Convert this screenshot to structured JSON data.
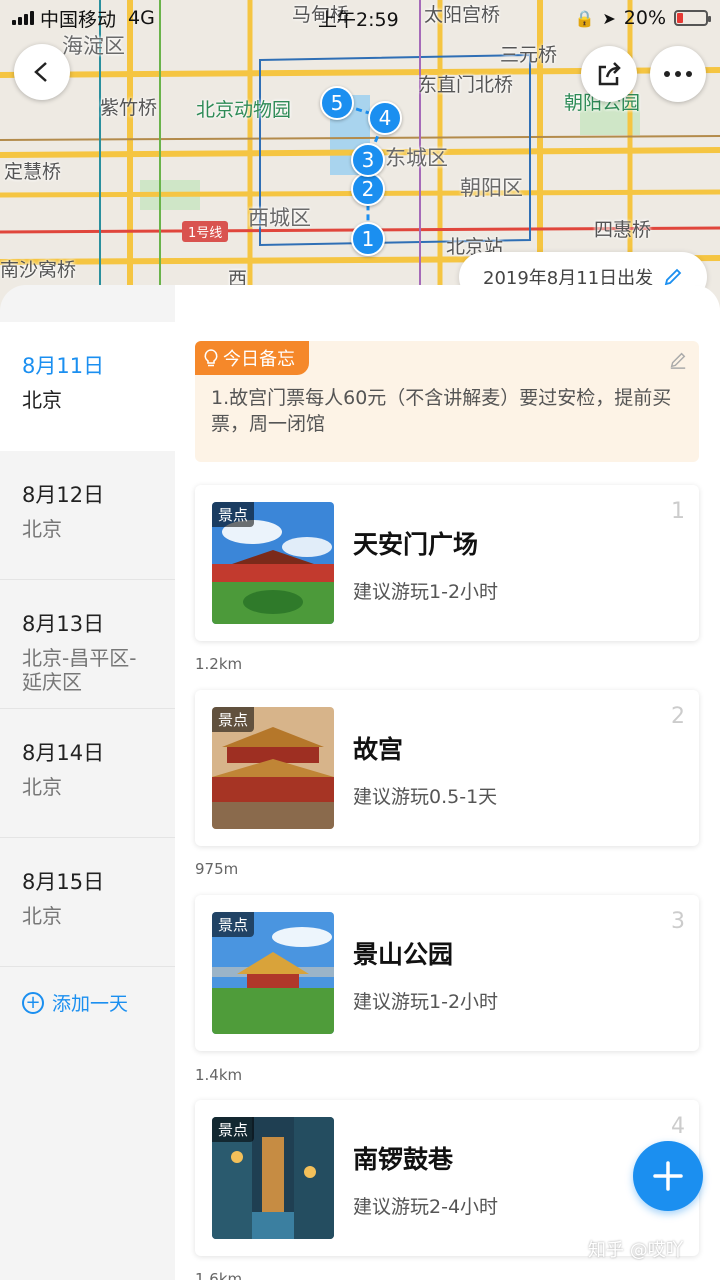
{
  "status_bar": {
    "carrier": "中国移动",
    "network": "4G",
    "time": "上午2:59",
    "battery_percent": "20%",
    "battery_level": 0.2
  },
  "map": {
    "labels": [
      "海淀区",
      "紫竹桥",
      "北京动物园",
      "东直门北桥",
      "三元桥",
      "东城区",
      "朝阳区",
      "西城区",
      "定慧桥",
      "四惠桥",
      "北京站",
      "南沙窝桥",
      "1号线",
      "马甸桥",
      "太阳宫桥",
      "朝阳公园",
      "西"
    ],
    "pins": [
      "1",
      "2",
      "3",
      "4",
      "5"
    ]
  },
  "date_pill": "2019年8月11日出发",
  "sidebar": {
    "days": [
      {
        "date": "8月11日",
        "city": "北京"
      },
      {
        "date": "8月12日",
        "city": "北京"
      },
      {
        "date": "8月13日",
        "city": "北京-昌平区-延庆区"
      },
      {
        "date": "8月14日",
        "city": "北京"
      },
      {
        "date": "8月15日",
        "city": "北京"
      }
    ],
    "add_day": "添加一天"
  },
  "memo": {
    "tag": "今日备忘",
    "text": "1.故宫门票每人60元（不含讲解麦）要过安检，提前买票，周一闭馆"
  },
  "spots": [
    {
      "tag": "景点",
      "name": "天安门广场",
      "sub": "建议游玩1-2小时",
      "num": "1"
    },
    {
      "tag": "景点",
      "name": "故宫",
      "sub": "建议游玩0.5-1天",
      "num": "2"
    },
    {
      "tag": "景点",
      "name": "景山公园",
      "sub": "建议游玩1-2小时",
      "num": "3"
    },
    {
      "tag": "景点",
      "name": "南锣鼓巷",
      "sub": "建议游玩2-4小时",
      "num": "4"
    }
  ],
  "distances": [
    "1.2km",
    "975m",
    "1.4km",
    "1.6km"
  ],
  "watermark": "知乎 @哎吖",
  "colors": {
    "accent": "#1b8ff0",
    "memo_tag": "#f5882a",
    "memo_bg": "#fdf3e6"
  }
}
